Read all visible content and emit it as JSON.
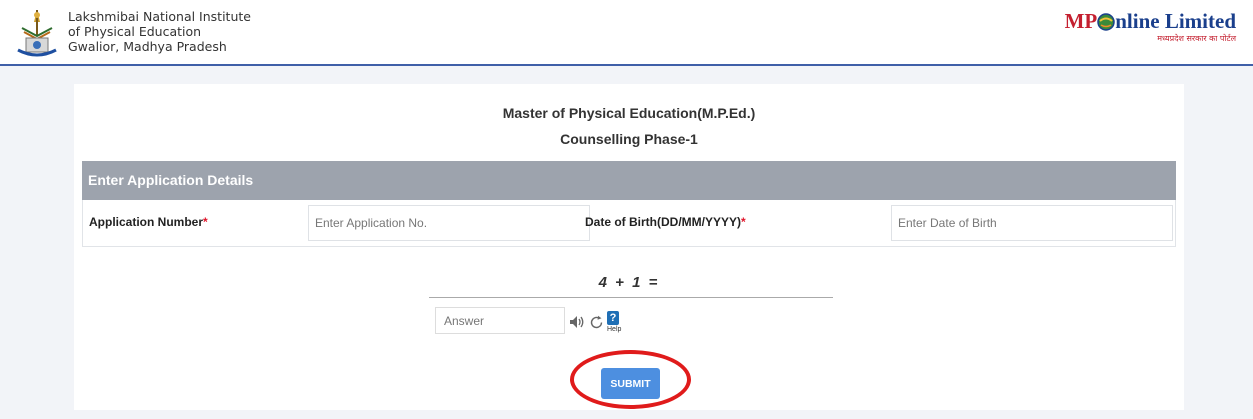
{
  "header": {
    "institute_line1": "Lakshmibai National Institute",
    "institute_line2": "of Physical Education",
    "institute_line3": "Gwalior, Madhya Pradesh",
    "partner_brand_prefix": "MP",
    "partner_brand_suffix": "nline Limited",
    "partner_tagline": "मध्यप्रदेश सरकार का पोर्टल",
    "logo_icon": "institute-emblem-icon",
    "brand_icon": "globe-icon"
  },
  "page": {
    "title": "Master of Physical Education(M.P.Ed.)",
    "subtitle": "Counselling Phase-1"
  },
  "form": {
    "section_title": "Enter Application Details",
    "app_no_label": "Application Number",
    "app_no_placeholder": "Enter Application No.",
    "app_no_value": "",
    "dob_label": "Date of Birth(DD/MM/YYYY)",
    "dob_placeholder": "Enter Date of Birth",
    "dob_value": "",
    "required_mark": "*"
  },
  "captcha": {
    "expression": "4 + 1 =",
    "answer_placeholder": "Answer",
    "answer_value": "",
    "audio_icon": "speaker-icon",
    "refresh_icon": "refresh-icon",
    "help_mark": "?",
    "help_label": "Help"
  },
  "actions": {
    "submit_label": "SUBMIT"
  },
  "colors": {
    "section_header": "#9da3ad",
    "submit_button": "#4d8fe0",
    "required_asterisk": "#e0162b",
    "highlight_annotation": "#e01b1b",
    "header_rule": "#3f5fa8"
  }
}
